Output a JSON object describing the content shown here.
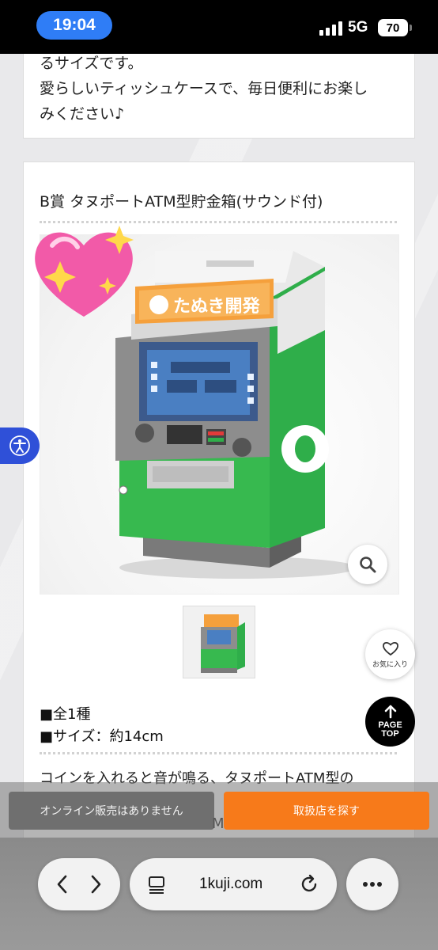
{
  "status_bar": {
    "time": "19:04",
    "network": "5G",
    "battery": "70"
  },
  "description": {
    "text": "るサイズです。\n愛らしいティッシュケースで、毎日便利にお楽し\nみください♪"
  },
  "prize": {
    "title": "B賞 タヌポートATM型貯金箱(サウンド付)",
    "product_sign": "たぬき開発",
    "specs": [
      "■全1種",
      "■サイズ：約14cm"
    ],
    "body_line": "コインを入れると音が鳴る、タヌポートATM型の",
    "body_line_partial": "M"
  },
  "floating": {
    "favorite_label": "お気に入り",
    "pagetop_line1": "PAGE",
    "pagetop_line2": "TOP"
  },
  "actions": {
    "online": "オンライン販売はありません",
    "find_store": "取扱店を探す"
  },
  "browser": {
    "url": "1kuji.com"
  },
  "colors": {
    "accent_orange": "#f77a1a",
    "atm_green": "#2fae4a",
    "status_blue": "#2f7df6"
  }
}
